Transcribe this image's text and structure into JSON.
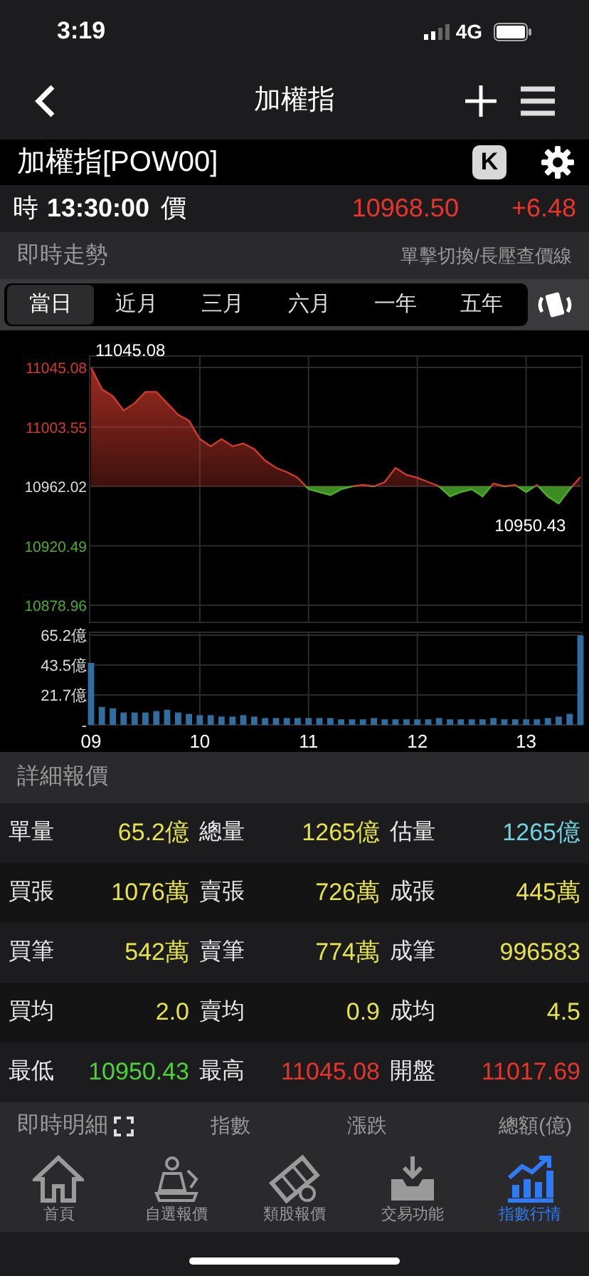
{
  "status_bar": {
    "time": "3:19",
    "network": "4G"
  },
  "nav": {
    "title": "加權指"
  },
  "instrument": {
    "name": "加權指[POW00]",
    "k_label": "K"
  },
  "quote": {
    "time_label": "時",
    "time": "13:30:00",
    "price_label": "價",
    "price": "10968.50",
    "change": "+6.48"
  },
  "trend_header": {
    "title": "即時走勢",
    "hint": "單擊切換/長壓查價線"
  },
  "tabs": [
    {
      "label": "當日",
      "selected": true
    },
    {
      "label": "近月",
      "selected": false
    },
    {
      "label": "三月",
      "selected": false
    },
    {
      "label": "六月",
      "selected": false
    },
    {
      "label": "一年",
      "selected": false
    },
    {
      "label": "五年",
      "selected": false
    }
  ],
  "price_chart": {
    "chart_data": {
      "type": "area",
      "x": [
        9.0,
        9.1,
        9.2,
        9.3,
        9.4,
        9.5,
        9.6,
        9.7,
        9.8,
        9.9,
        10.0,
        10.1,
        10.2,
        10.3,
        10.4,
        10.5,
        10.6,
        10.7,
        10.8,
        10.9,
        11.0,
        11.1,
        11.2,
        11.3,
        11.4,
        11.5,
        11.6,
        11.7,
        11.8,
        11.9,
        12.0,
        12.1,
        12.2,
        12.3,
        12.4,
        12.5,
        12.6,
        12.7,
        12.8,
        12.9,
        13.0,
        13.1,
        13.2,
        13.3,
        13.4,
        13.5
      ],
      "series": [
        {
          "color": "#d0392b",
          "values": [
            11045,
            11030,
            11025,
            11015,
            11020,
            11028,
            11028,
            11020,
            11012,
            11008,
            10995,
            10990,
            10995,
            10990,
            10992,
            10988,
            10980,
            10975,
            10972,
            10968,
            10960,
            10958,
            10956,
            10960,
            10962,
            10963,
            10962,
            10965,
            10975,
            10970,
            10968,
            10965,
            10962,
            10955,
            10958,
            10960,
            10955,
            10964,
            10962,
            10963,
            10958,
            10963,
            10955,
            10950,
            10960,
            10968.5
          ]
        }
      ],
      "grid": true,
      "ylim": [
        10878.96,
        11045.08
      ],
      "xlim": [
        9.0,
        13.5
      ],
      "yticks": [
        11045.08,
        11003.55,
        10962.02,
        10920.49,
        10878.96
      ],
      "annotations": [
        {
          "x": 9.0,
          "y": 11045.08,
          "text": "11045.08"
        },
        {
          "x": 13.3,
          "y": 10950.43,
          "text": "10950.43"
        }
      ]
    }
  },
  "volume_chart": {
    "chart_data": {
      "type": "bar",
      "x": [
        9.0,
        9.1,
        9.2,
        9.3,
        9.4,
        9.5,
        9.6,
        9.7,
        9.8,
        9.9,
        10.0,
        10.1,
        10.2,
        10.3,
        10.4,
        10.5,
        10.6,
        10.7,
        10.8,
        10.9,
        11.0,
        11.1,
        11.2,
        11.3,
        11.4,
        11.5,
        11.6,
        11.7,
        11.8,
        11.9,
        12.0,
        12.1,
        12.2,
        12.3,
        12.4,
        12.5,
        12.6,
        12.7,
        12.8,
        12.9,
        13.0,
        13.1,
        13.2,
        13.3,
        13.4,
        13.5
      ],
      "series": [
        {
          "color": "#2f6e9e",
          "values": [
            45,
            13,
            12,
            9,
            9,
            9,
            10,
            11,
            9,
            8,
            7,
            7,
            6,
            6,
            7,
            6,
            5,
            5,
            5,
            5,
            5,
            5,
            5,
            4,
            4,
            4,
            5,
            4,
            4,
            4,
            4,
            4,
            5,
            4,
            4,
            4,
            4,
            5,
            4,
            4,
            4,
            4,
            5,
            6,
            8,
            65
          ]
        }
      ],
      "grid": true,
      "ylim": [
        0,
        65.2
      ],
      "xlim": [
        9.0,
        13.5
      ],
      "xticks": [
        {
          "value": 9,
          "label": "09"
        },
        {
          "value": 10,
          "label": "10"
        },
        {
          "value": 11,
          "label": "11"
        },
        {
          "value": 12,
          "label": "12"
        },
        {
          "value": 13,
          "label": "13"
        }
      ],
      "yticks": [
        {
          "value": 0,
          "label": "-"
        },
        {
          "value": 21.7,
          "label": "21.7億"
        },
        {
          "value": 43.5,
          "label": "43.5億"
        },
        {
          "value": 65.2,
          "label": "65.2億"
        }
      ]
    }
  },
  "detail_header": {
    "title": "詳細報價"
  },
  "details": [
    [
      {
        "label": "單量",
        "value": "65.2億",
        "color": "#e6e34a"
      },
      {
        "label": "總量",
        "value": "1265億",
        "color": "#e6e34a"
      },
      {
        "label": "估量",
        "value": "1265億",
        "color": "#6fd3e0"
      }
    ],
    [
      {
        "label": "買張",
        "value": "1076萬",
        "color": "#e6e34a"
      },
      {
        "label": "賣張",
        "value": "726萬",
        "color": "#e6e34a"
      },
      {
        "label": "成張",
        "value": "445萬",
        "color": "#e6e34a"
      }
    ],
    [
      {
        "label": "買筆",
        "value": "542萬",
        "color": "#e6e34a"
      },
      {
        "label": "賣筆",
        "value": "774萬",
        "color": "#e6e34a"
      },
      {
        "label": "成筆",
        "value": "996583",
        "color": "#e6e34a"
      }
    ],
    [
      {
        "label": "買均",
        "value": "2.0",
        "color": "#e6e34a"
      },
      {
        "label": "賣均",
        "value": "0.9",
        "color": "#e6e34a"
      },
      {
        "label": "成均",
        "value": "4.5",
        "color": "#e6e34a"
      }
    ],
    [
      {
        "label": "最低",
        "value": "10950.43",
        "color": "#4cd137"
      },
      {
        "label": "最高",
        "value": "11045.08",
        "color": "#e8352b"
      },
      {
        "label": "開盤",
        "value": "11017.69",
        "color": "#e8352b"
      }
    ]
  ],
  "ticks_header": {
    "title": "即時明細",
    "columns": [
      "指數",
      "漲跌",
      "總額(億)"
    ]
  },
  "bottom_nav": [
    {
      "label": "首頁",
      "kind": "home",
      "selected": false
    },
    {
      "label": "自選報價",
      "kind": "person",
      "selected": false
    },
    {
      "label": "類股報價",
      "kind": "film",
      "selected": false
    },
    {
      "label": "交易功能",
      "kind": "inbox",
      "selected": false
    },
    {
      "label": "指數行情",
      "kind": "chart",
      "selected": true
    }
  ]
}
